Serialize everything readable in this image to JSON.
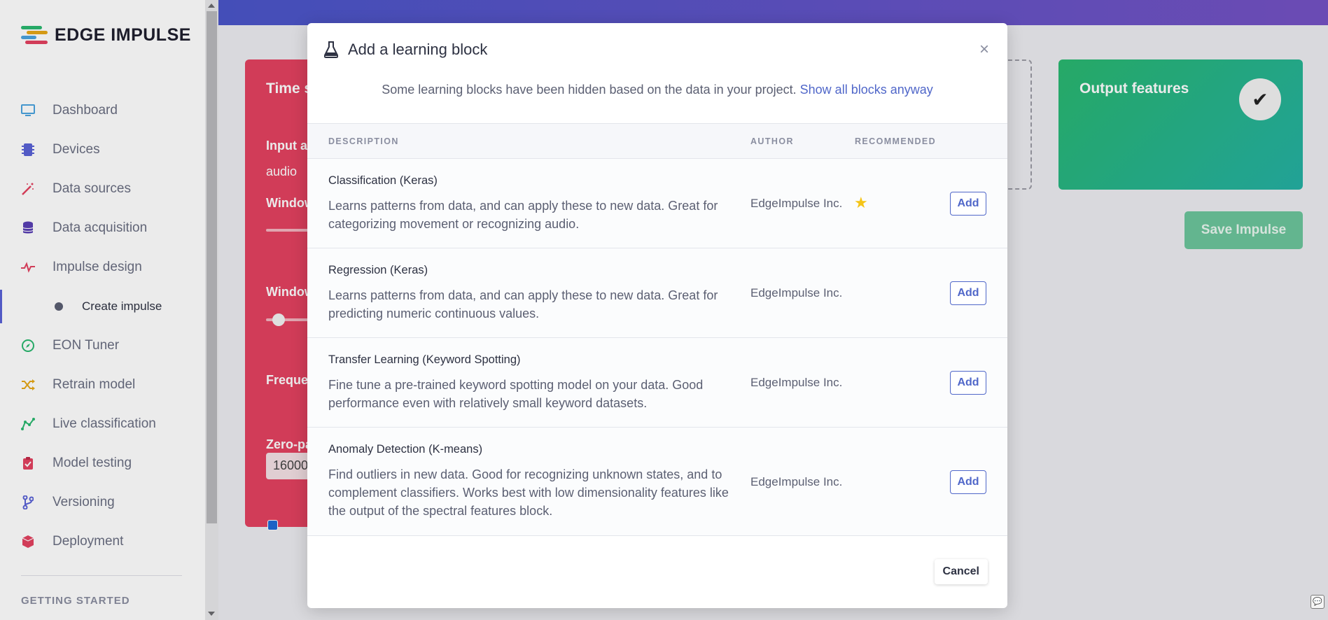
{
  "app": {
    "logo_text": "EDGE IMPULSE"
  },
  "sidebar": {
    "items": [
      {
        "label": "Dashboard",
        "icon": "monitor-icon",
        "color": "#4aa3df"
      },
      {
        "label": "Devices",
        "icon": "chip-icon",
        "color": "#5a62d6"
      },
      {
        "label": "Data sources",
        "icon": "wand-icon",
        "color": "#e34260"
      },
      {
        "label": "Data acquisition",
        "icon": "database-icon",
        "color": "#5a3fb5"
      },
      {
        "label": "Impulse design",
        "icon": "pulse-icon",
        "color": "#e34260"
      },
      {
        "label": "Create impulse",
        "icon": "dot-icon",
        "color": "#5b5f72"
      },
      {
        "label": "EON Tuner",
        "icon": "compass-icon",
        "color": "#2ab86f"
      },
      {
        "label": "Retrain model",
        "icon": "shuffle-icon",
        "color": "#e6a817"
      },
      {
        "label": "Live classification",
        "icon": "graph-icon",
        "color": "#2ab86f"
      },
      {
        "label": "Model testing",
        "icon": "clipboard-check-icon",
        "color": "#e34260"
      },
      {
        "label": "Versioning",
        "icon": "branch-icon",
        "color": "#5a62d6"
      },
      {
        "label": "Deployment",
        "icon": "cube-icon",
        "color": "#e34260"
      }
    ],
    "section_label": "GETTING STARTED"
  },
  "background": {
    "time_card_title": "Time s",
    "input_label": "Input a",
    "input_value": "audio",
    "window_label_1": "Window",
    "window_label_2": "Window",
    "frequency_label": "Freque",
    "frequency_value": "16000",
    "zero_pad_label": "Zero-pa",
    "output_title": "Output features",
    "save_label": "Save Impulse"
  },
  "modal": {
    "title": "Add a learning block",
    "notice": "Some learning blocks have been hidden based on the data in your project.",
    "notice_link": "Show all blocks anyway",
    "columns": {
      "description": "DESCRIPTION",
      "author": "AUTHOR",
      "recommended": "RECOMMENDED"
    },
    "rows": [
      {
        "name": "Classification (Keras)",
        "description": "Learns patterns from data, and can apply these to new data. Great for categorizing movement or recognizing audio.",
        "author": "EdgeImpulse Inc.",
        "recommended": true,
        "add_label": "Add"
      },
      {
        "name": "Regression (Keras)",
        "description": "Learns patterns from data, and can apply these to new data. Great for predicting numeric continuous values.",
        "author": "EdgeImpulse Inc.",
        "recommended": false,
        "add_label": "Add"
      },
      {
        "name": "Transfer Learning (Keyword Spotting)",
        "description": "Fine tune a pre-trained keyword spotting model on your data. Good performance even with relatively small keyword datasets.",
        "author": "EdgeImpulse Inc.",
        "recommended": false,
        "add_label": "Add"
      },
      {
        "name": "Anomaly Detection (K-means)",
        "description": "Find outliers in new data. Good for recognizing unknown states, and to complement classifiers. Works best with low dimensionality features like the output of the spectral features block.",
        "author": "EdgeImpulse Inc.",
        "recommended": false,
        "add_label": "Add"
      }
    ],
    "cancel_label": "Cancel"
  }
}
